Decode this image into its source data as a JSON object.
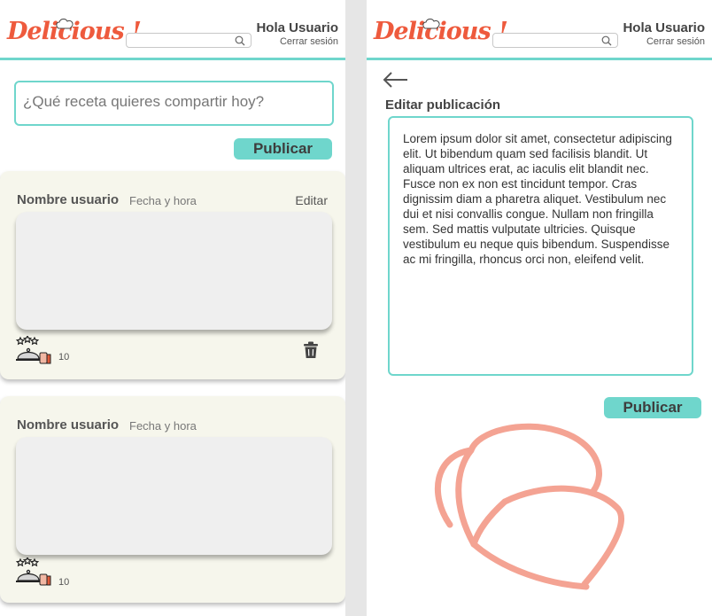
{
  "header": {
    "logo_text": "Delicious !",
    "user_greeting": "Hola Usuario",
    "logout_label": "Cerrar sesión",
    "search_value": "",
    "icons": {
      "search": "search-icon",
      "logo_decoration": "chef-hat-icon"
    }
  },
  "colors": {
    "accent": "#6fd6cc",
    "brand": "#ee5a3d",
    "card_bg": "#f6f6ec",
    "hat_outline": "#f4a393"
  },
  "feed": {
    "compose_placeholder": "¿Qué receta quieres compartir hoy?",
    "publish_label": "Publicar",
    "posts": [
      {
        "user": "Nombre usuario",
        "date": "Fecha y hora",
        "edit_label": "Editar",
        "rating_count": "10",
        "icons": [
          "rated-dish-icon",
          "trash-icon"
        ]
      },
      {
        "user": "Nombre usuario",
        "date": "Fecha y hora",
        "rating_count": "10",
        "icons": [
          "rated-dish-icon"
        ]
      }
    ]
  },
  "editor": {
    "title": "Editar publicación",
    "body": "Lorem ipsum dolor sit amet, consectetur adipiscing elit. Ut bibendum quam sed facilisis blandit. Ut aliquam ultrices erat, ac iaculis elit blandit nec. Fusce non ex non est tincidunt tempor. Cras dignissim diam a pharetra aliquet. Vestibulum nec dui et nisi convallis congue. Nullam non fringilla sem. Sed mattis vulputate ultricies. Quisque vestibulum eu neque quis bibendum. Suspendisse ac mi fringilla, rhoncus orci non, eleifend velit.",
    "publish_label": "Publicar",
    "icons": {
      "back": "back-arrow-icon",
      "watermark": "chef-hat-icon"
    }
  }
}
